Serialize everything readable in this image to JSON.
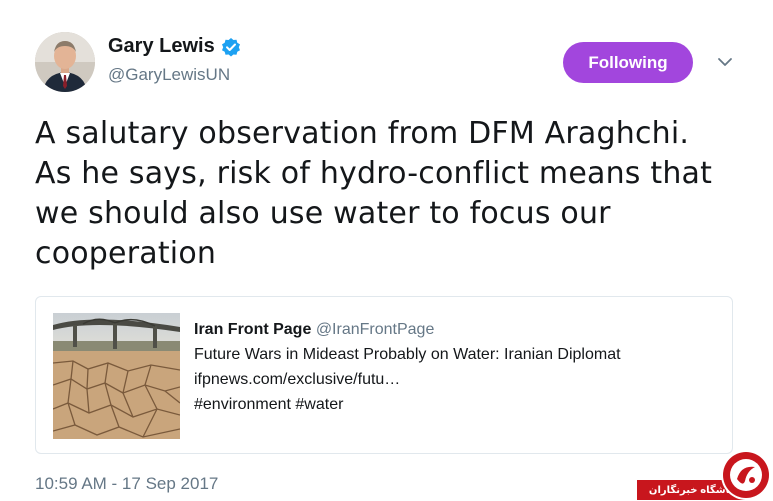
{
  "author": {
    "name": "Gary Lewis",
    "handle": "@GaryLewisUN",
    "verified": true
  },
  "follow_button": {
    "label": "Following",
    "color": "#a246dd"
  },
  "menu": {
    "icon": "chevron-down-icon"
  },
  "tweet": {
    "lines": [
      "A salutary observation from DFM Araghchi.",
      "As he says, risk of hydro-conflict means that",
      "we should also use water to focus our",
      "cooperation"
    ],
    "timestamp": "10:59 AM - 17 Sep 2017"
  },
  "quoted_card": {
    "author_name": "Iran Front Page",
    "author_handle": "@IranFrontPage",
    "headline": "Future Wars in Mideast Probably on Water: Iranian Diplomat",
    "link": "ifpnews.com/exclusive/futu…",
    "hashtags": "#environment #water",
    "image": "cracked-dry-riverbed-under-bridge"
  },
  "watermark": {
    "text": "باشگاه خبرنگاران",
    "color": "#c8161d"
  }
}
